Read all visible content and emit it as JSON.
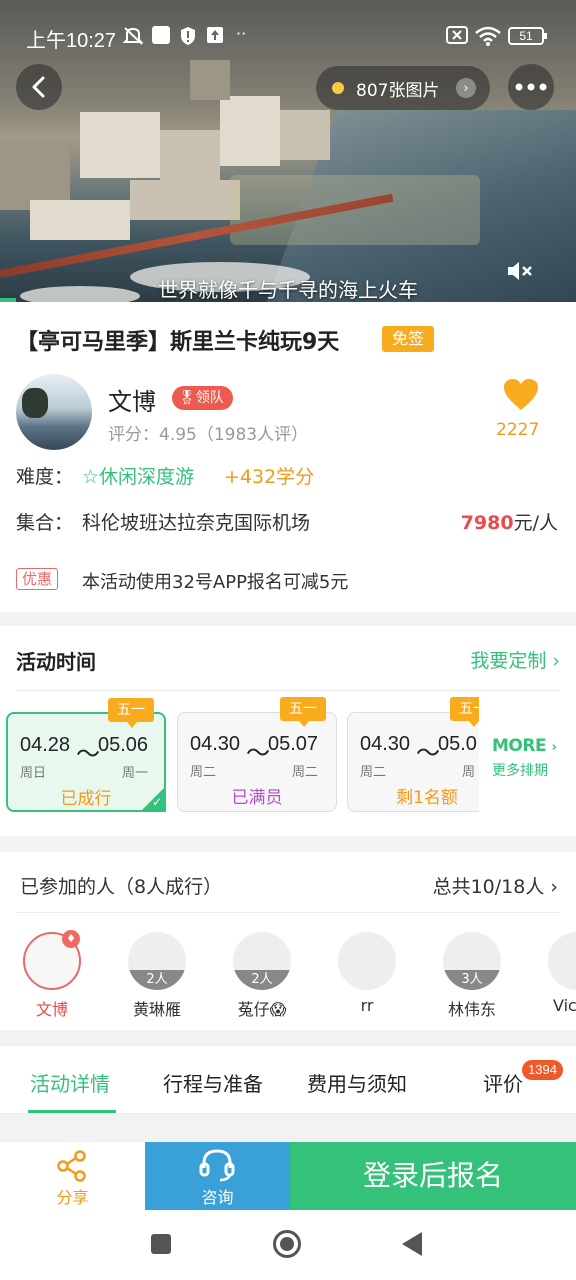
{
  "status_bar": {
    "time": "上午10:27",
    "battery": "51"
  },
  "hero": {
    "photo_count": "807张图片",
    "caption": "世界就像千与千寻的海上火车"
  },
  "trip": {
    "title": "【亭可马里季】斯里兰卡纯玩9天",
    "visa_tag": "免签",
    "leader_name": "文博",
    "leader_badge": "领队",
    "rating": "评分：4.95（1983人评）",
    "likes": "2227",
    "difficulty_label": "难度：",
    "difficulty_value": "☆休闲深度游",
    "difficulty_points": "+432学分",
    "meet_label": "集合：",
    "meet_value": "科伦坡班达拉奈克国际机场",
    "price_value": "7980",
    "price_unit": "元/人",
    "promo_tag": "优惠",
    "promo_text": "本活动使用32号APP报名可减5元"
  },
  "schedule": {
    "title": "活动时间",
    "customize": "我要定制",
    "dates": [
      {
        "tag": "五一",
        "start": "04.28",
        "end": "05.06",
        "start_wd": "周日",
        "end_wd": "周一",
        "status": "已成行"
      },
      {
        "tag": "五一",
        "start": "04.30",
        "end": "05.07",
        "start_wd": "周二",
        "end_wd": "周二",
        "status": "已满员"
      },
      {
        "tag": "五一",
        "start": "04.30",
        "end": "05.0",
        "start_wd": "周二",
        "end_wd": "周",
        "status": "剩1名额"
      }
    ],
    "more": "MORE",
    "more_sub": "更多排期"
  },
  "participants": {
    "title": "已参加的人（8人成行）",
    "total": "总共10/18人",
    "people": [
      {
        "name": "文博",
        "count": ""
      },
      {
        "name": "黄琳雁",
        "count": "2人"
      },
      {
        "name": "菟仔😱",
        "count": "2人"
      },
      {
        "name": "rr",
        "count": ""
      },
      {
        "name": "林伟东",
        "count": "3人"
      },
      {
        "name": "Vic",
        "count": ""
      }
    ]
  },
  "tabs": {
    "items": [
      "活动详情",
      "行程与准备",
      "费用与须知",
      "评价"
    ],
    "review_count": "1394"
  },
  "actions": {
    "share": "分享",
    "consult": "咨询",
    "signup": "登录后报名"
  },
  "colors": {
    "accent": "#34c27a",
    "orange": "#f9ab1e",
    "price_red": "#e84c4c",
    "consult_blue": "#3aa0d8"
  }
}
